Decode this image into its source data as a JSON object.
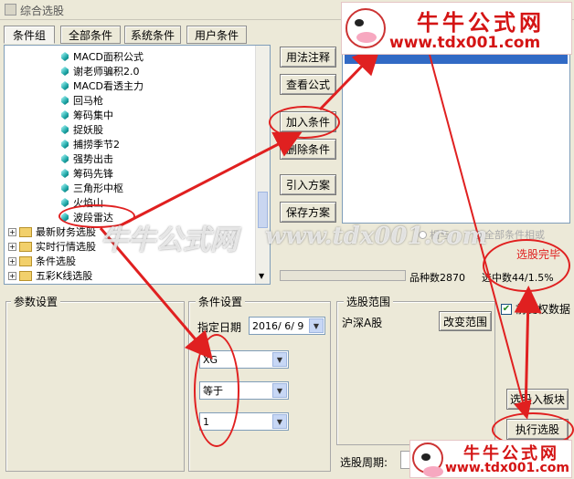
{
  "window": {
    "title": "综合选股"
  },
  "tabs": [
    {
      "label": "条件组",
      "active": true
    },
    {
      "label": "全部条件",
      "active": false
    },
    {
      "label": "系统条件",
      "active": false
    },
    {
      "label": "用户条件",
      "active": false
    }
  ],
  "tree": {
    "formulas": [
      "MACD面积公式",
      "谢老师骗积2.0",
      "MACD看透主力",
      "回马枪",
      "筹码集中",
      "捉妖股",
      "捕捞季节2",
      "强势出击",
      "筹码先锋",
      "三角形中枢",
      "火焰山",
      "波段雷达"
    ],
    "folders": [
      "最新财务选股",
      "实时行情选股",
      "条件选股",
      "五彩K线选股"
    ]
  },
  "buttons": {
    "usage_note": "用法注释",
    "view_formula": "查看公式",
    "add_condition": "加入条件",
    "delete_condition": "删除条件",
    "import_scheme": "引入方案",
    "save_scheme": "保存方案",
    "change_range": "改变范围",
    "select_to_board": "选股入板块",
    "execute": "执行选股"
  },
  "status": {
    "stock_count_label": "品种数",
    "stock_count": "2870",
    "selected_label": "选中数",
    "selected_value": "44/1.5%",
    "done_text": "选股完毕",
    "and_label": "相与",
    "or_label": "全部条件相或"
  },
  "params_panel": {
    "label": "参数设置"
  },
  "condition_panel": {
    "label": "条件设置",
    "date_label": "指定日期",
    "date_value": "2016/ 6/ 9",
    "combo1": "XG",
    "combo2": "等于",
    "combo3": "1"
  },
  "range_panel": {
    "label": "选股范围",
    "value": "沪深A股"
  },
  "rights_checkbox": {
    "label": "前复权数据",
    "checked": true
  },
  "period": {
    "label": "选股周期:"
  },
  "watermark": {
    "logo_cn": "牛牛公式网",
    "logo_url": "www.tdx001.com",
    "overlay_cn": "牛牛公式网",
    "overlay_url": "www.tdx001.com"
  },
  "colors": {
    "annotation": "#e02020",
    "brand": "#d41414",
    "selection": "#316ac5"
  }
}
